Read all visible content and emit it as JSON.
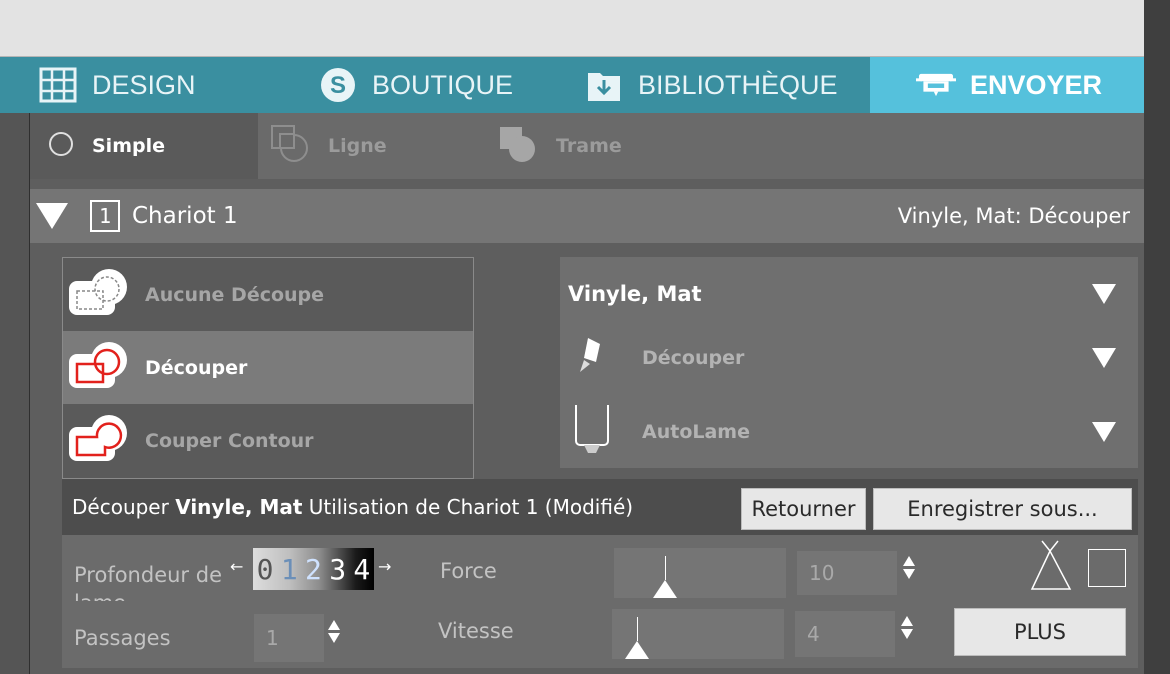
{
  "main_tabs": [
    {
      "label": "DESIGN",
      "icon": "grid-icon"
    },
    {
      "label": "BOUTIQUE",
      "icon": "silhouette-s-icon"
    },
    {
      "label": "BIBLIOTHÈQUE",
      "icon": "download-box-icon"
    },
    {
      "label": "ENVOYER",
      "icon": "cutter-icon",
      "active": true
    }
  ],
  "sub_tabs": [
    {
      "label": "Simple",
      "icon": "radio-circle-icon",
      "active": true
    },
    {
      "label": "Ligne",
      "icon": "overlapping-squares-icon"
    },
    {
      "label": "Trame",
      "icon": "square-circle-icon"
    }
  ],
  "chariot": {
    "number": "1",
    "label": "Chariot 1",
    "summary": "Vinyle, Mat: Découper"
  },
  "actions": [
    {
      "label": "Aucune Découpe",
      "icon": "no-cut-icon"
    },
    {
      "label": "Découper",
      "icon": "cut-icon",
      "selected": true
    },
    {
      "label": "Couper Contour",
      "icon": "cut-contour-icon"
    }
  ],
  "material": {
    "name": "Vinyle, Mat",
    "action": "Découper",
    "tool": "AutoLame"
  },
  "info": {
    "part1": "Découper ",
    "material": "Vinyle, Mat",
    "part2": " Utilisation de Chariot 1 (Modifié)",
    "return_button": "Retourner",
    "save_button": "Enregistrer sous..."
  },
  "params": {
    "depth_label": "Profondeur de lame",
    "depth_left_arrow": "←",
    "depth_right_arrow": "→",
    "depth_digits": [
      "0",
      "1",
      "2",
      "3",
      "4"
    ],
    "passes_label": "Passages",
    "passes_value": "1",
    "force_label": "Force",
    "force_value": "10",
    "speed_label": "Vitesse",
    "speed_value": "4",
    "more_button": "PLUS"
  },
  "colors": {
    "nav_bg": "#3a8fa0",
    "nav_active": "#55c1dc",
    "cut_red": "#e2211c"
  }
}
